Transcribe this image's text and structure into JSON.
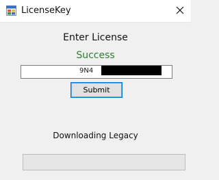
{
  "window": {
    "title": "LicenseKey",
    "icon": "app-window-icon"
  },
  "main": {
    "heading": "Enter License",
    "status": "Success",
    "status_color": "#2e7d32",
    "license_value": "9N4",
    "submit_label": "Submit",
    "download_label": "Downloading Legacy",
    "progress_fraction": 0
  },
  "colors": {
    "accent": "#0078d7",
    "success": "#2e7d32"
  }
}
